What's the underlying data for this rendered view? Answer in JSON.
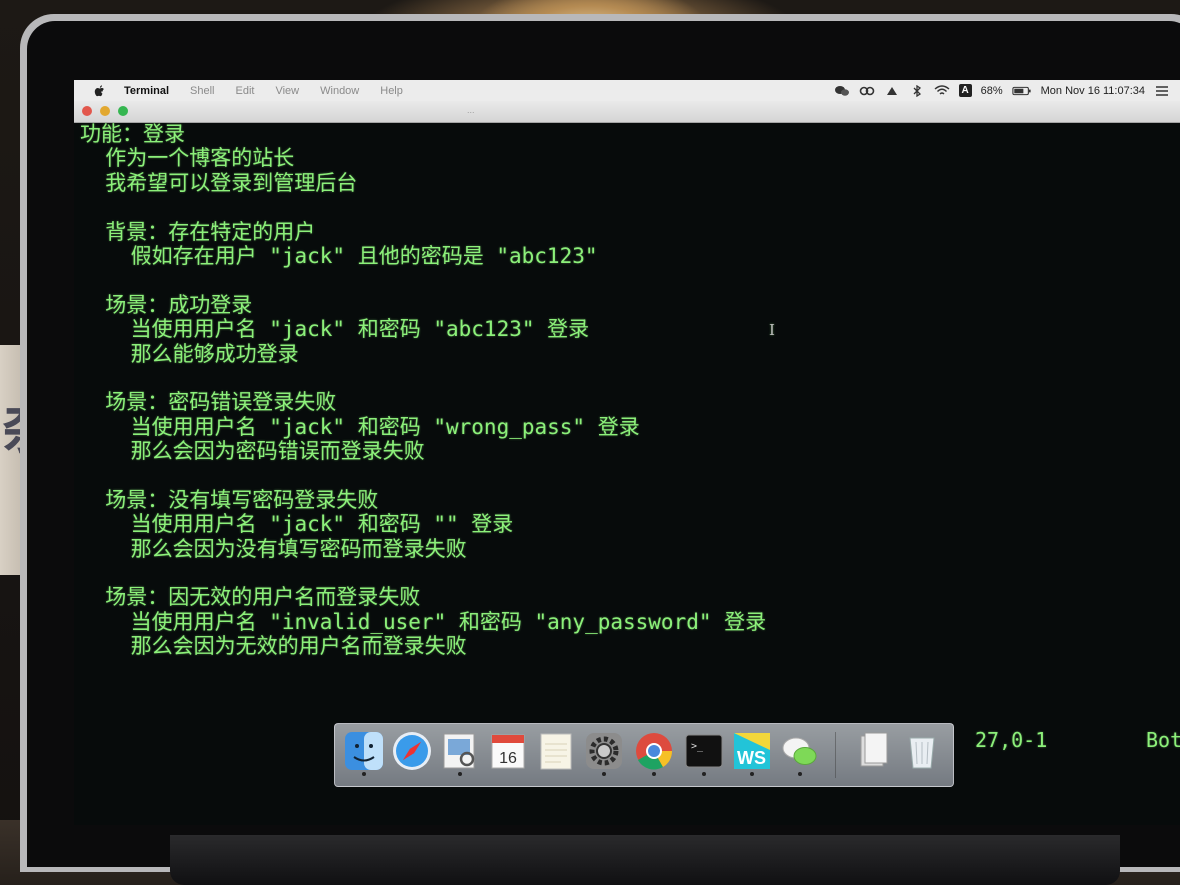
{
  "menubar": {
    "apple_icon": "apple-logo-icon",
    "app_name": "Terminal",
    "items": [
      "Shell",
      "Edit",
      "View",
      "Window",
      "Help"
    ],
    "input_method": "A",
    "battery": "68%",
    "datetime": "Mon Nov 16  11:07:34"
  },
  "window": {
    "title": "..."
  },
  "terminal": {
    "lines": [
      "功能：登录",
      "  作为一个博客的站长",
      "  我希望可以登录到管理后台",
      "",
      "  背景：存在特定的用户",
      "    假如存在用户 \"jack\" 且他的密码是 \"abc123\"",
      "",
      "  场景：成功登录",
      "    当使用用户名 \"jack\" 和密码 \"abc123\" 登录",
      "    那么能够成功登录",
      "",
      "  场景：密码错误登录失败",
      "    当使用用户名 \"jack\" 和密码 \"wrong_pass\" 登录",
      "    那么会因为密码错误而登录失败",
      "",
      "  场景：没有填写密码登录失败",
      "    当使用用户名 \"jack\" 和密码 \"\" 登录",
      "    那么会因为没有填写密码而登录失败",
      "",
      "  场景：因无效的用户名而登录失败",
      "    当使用用户名 \"invalid_user\" 和密码 \"any_password\" 登录",
      "    那么会因为无效的用户名而登录失败"
    ],
    "cursor_position": "27,0-1",
    "scroll_position": "Bot"
  },
  "dock": {
    "items": [
      {
        "name": "finder",
        "icon": "finder-icon"
      },
      {
        "name": "safari",
        "icon": "safari-icon"
      },
      {
        "name": "preview",
        "icon": "preview-icon"
      },
      {
        "name": "calendar",
        "icon": "calendar-icon",
        "label": "16"
      },
      {
        "name": "notes",
        "icon": "notes-icon"
      },
      {
        "name": "system-preferences",
        "icon": "gear-icon"
      },
      {
        "name": "chrome",
        "icon": "chrome-icon"
      },
      {
        "name": "terminal",
        "icon": "terminal-icon",
        "label": ">_"
      },
      {
        "name": "webstorm",
        "icon": "webstorm-icon",
        "label": "WS"
      },
      {
        "name": "wechat",
        "icon": "wechat-icon"
      },
      {
        "name": "documents",
        "icon": "documents-icon"
      },
      {
        "name": "trash",
        "icon": "trash-icon"
      }
    ]
  }
}
